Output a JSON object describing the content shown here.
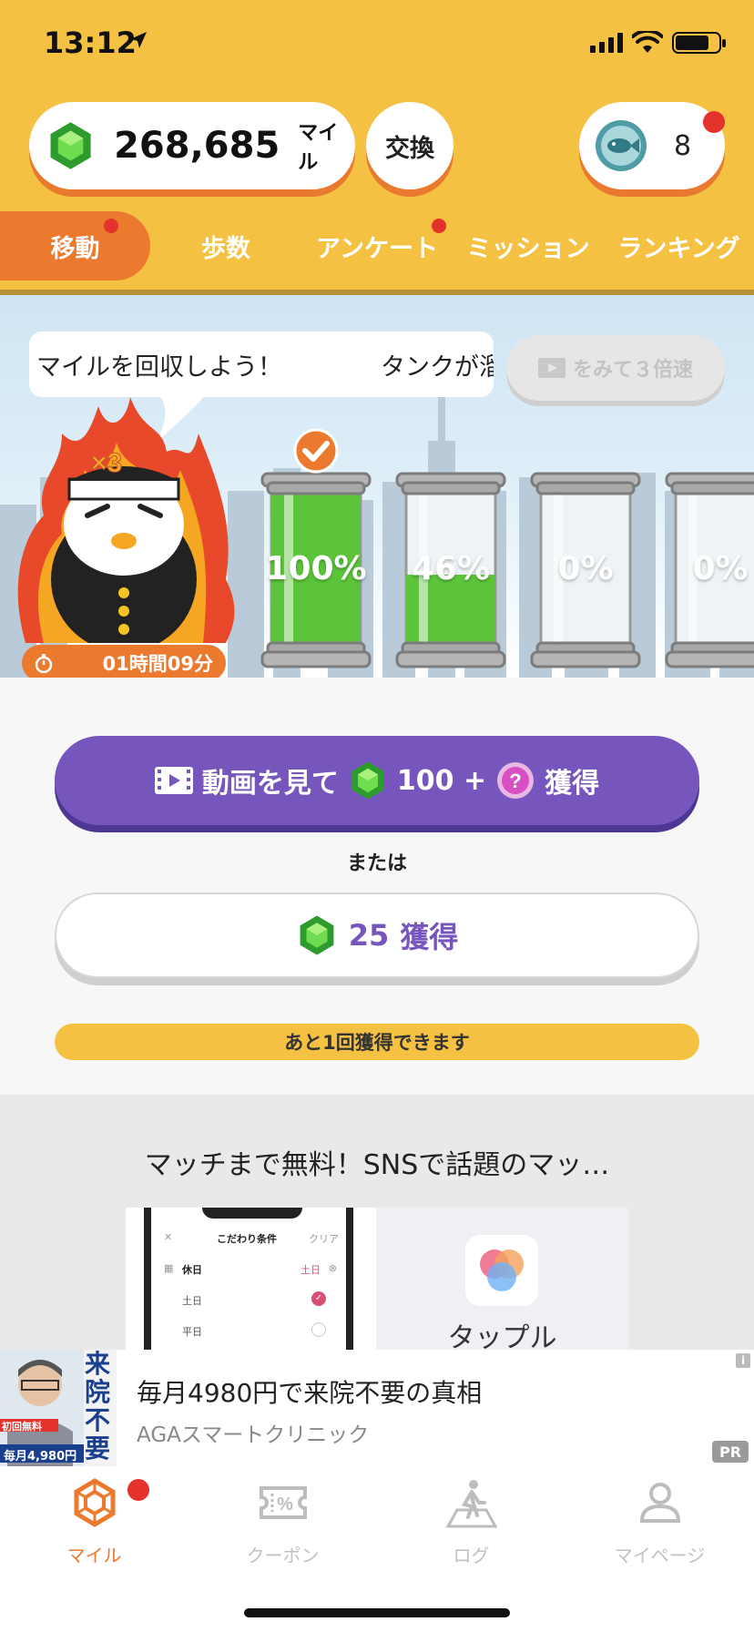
{
  "status_bar": {
    "time": "13:12"
  },
  "header": {
    "mile_value": "268,685",
    "mile_unit": "マイル",
    "exchange_label": "交換",
    "coin_count": "8"
  },
  "tabs": [
    {
      "label": "移動",
      "active": true,
      "badge": true
    },
    {
      "label": "歩数",
      "active": false,
      "badge": false
    },
    {
      "label": "アンケート",
      "active": false,
      "badge": true
    },
    {
      "label": "ミッション",
      "active": false,
      "badge": false
    },
    {
      "label": "ランキング",
      "active": false,
      "badge": false
    }
  ],
  "scene": {
    "bubble_text": "マイルを回収しよう！　　　　タンクが溜",
    "speed_button": "をみて３倍速",
    "multiplier": "×3",
    "timer": "01時間09分",
    "tanks": [
      {
        "percent_label": "100%",
        "fill": 1.0,
        "checked": true
      },
      {
        "percent_label": "46%",
        "fill": 0.46,
        "checked": false
      },
      {
        "percent_label": "0%",
        "fill": 0.0,
        "checked": false
      },
      {
        "percent_label": "0%",
        "fill": 0.0,
        "checked": false
      }
    ]
  },
  "actions": {
    "video_prefix": "動画を見て",
    "video_amount": "100 +",
    "video_suffix": "獲得",
    "or_label": "または",
    "earn_amount": "25",
    "earn_suffix": "獲得",
    "remaining": "あと1回獲得できます"
  },
  "ad": {
    "title": "マッチまで無料！SNSで話題のマッ…",
    "phone_rows": [
      "こだわり条件",
      "クリア",
      "休日",
      "土日",
      "土日",
      "平日"
    ],
    "brand_name": "タップル"
  },
  "banner": {
    "thumb_lines": [
      "来",
      "院",
      "不",
      "要"
    ],
    "thumb_badge": "初回無料",
    "thumb_price": "毎月4,980円",
    "title": "毎月4980円で来院不要の真相",
    "subtitle": "AGAスマートクリニック",
    "pr": "PR",
    "info": "i"
  },
  "bottom_nav": [
    {
      "label": "マイル",
      "icon": "hexagon-gem-icon",
      "active": true
    },
    {
      "label": "クーポン",
      "icon": "coupon-percent-icon",
      "active": false
    },
    {
      "label": "ログ",
      "icon": "walking-person-icon",
      "active": false
    },
    {
      "label": "マイページ",
      "icon": "person-icon",
      "active": false
    }
  ],
  "colors": {
    "header_yellow": "#f4c143",
    "accent_orange": "#ec7a2e",
    "purple": "#7656bd",
    "tank_green": "#5cc43a",
    "badge_red": "#e3322b"
  }
}
